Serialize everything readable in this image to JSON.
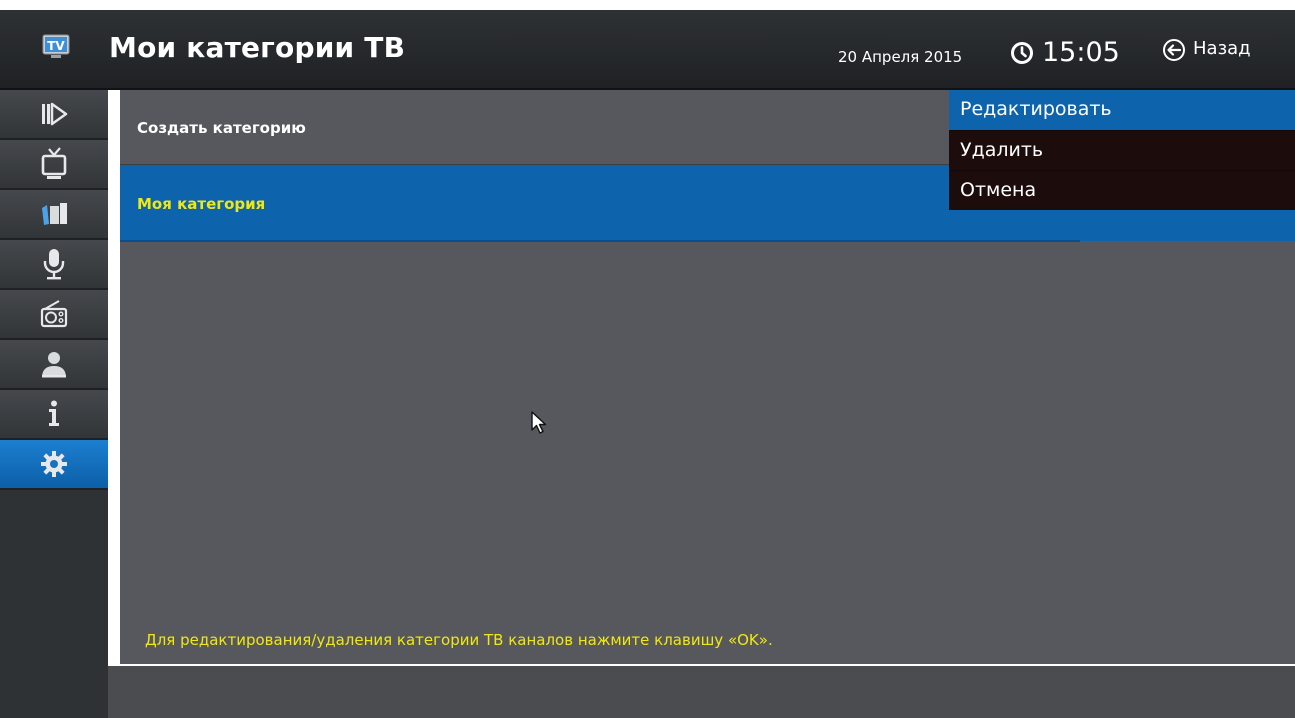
{
  "header": {
    "title": "Мои категории ТВ",
    "date": "20 Апреля 2015",
    "time": "15:05",
    "back_label": "Назад"
  },
  "sidebar": {
    "items": [
      {
        "icon": "play-icon"
      },
      {
        "icon": "tv-icon"
      },
      {
        "icon": "media-icon"
      },
      {
        "icon": "microphone-icon"
      },
      {
        "icon": "radio-icon"
      },
      {
        "icon": "user-icon"
      },
      {
        "icon": "info-icon"
      },
      {
        "icon": "gear-icon",
        "active": true
      }
    ]
  },
  "main": {
    "rows": [
      {
        "label": "Создать категорию"
      },
      {
        "label": "Моя категория",
        "selected": true
      }
    ],
    "hint": "Для редактирования/удаления категории ТВ каналов нажмите клавишу «OK»."
  },
  "context_menu": {
    "items": [
      {
        "label": "Редактировать",
        "selected": true
      },
      {
        "label": "Удалить"
      },
      {
        "label": "Отмена"
      }
    ]
  },
  "colors": {
    "accent_blue": "#0e63ad",
    "highlight_yellow": "#f0e813",
    "menu_dark": "#1d0c0c",
    "panel_gray": "#56585d"
  }
}
